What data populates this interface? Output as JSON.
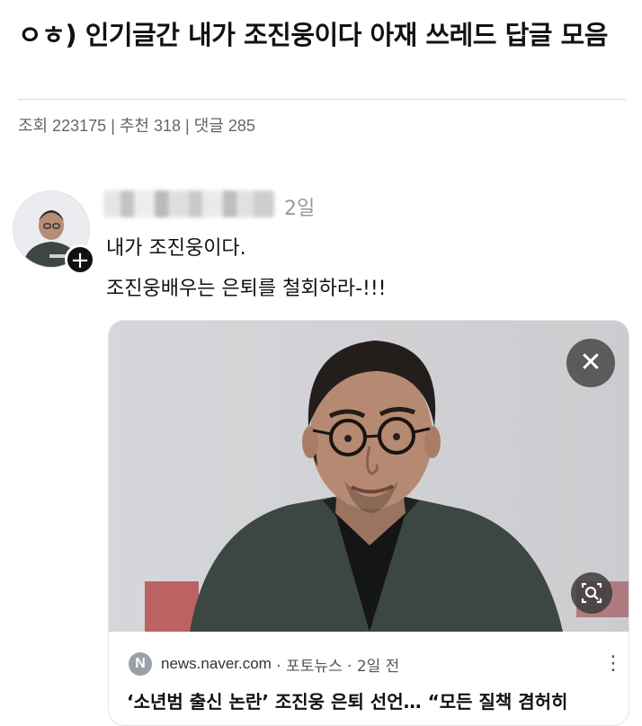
{
  "post": {
    "title": "ㅇㅎ) 인기글간 내가 조진웅이다 아재 쓰레드 답글 모음",
    "meta": {
      "views": "조회 223175",
      "sep1": " | ",
      "likes": "추천 318",
      "sep2": " | ",
      "comments": "댓글 285"
    }
  },
  "thread": {
    "time": "2일",
    "line1": "내가 조진웅이다.",
    "line2": "조진웅배우는 은퇴를 철회하라-!!!",
    "add_icon": "plus-icon"
  },
  "card": {
    "source_initial": "N",
    "source_site": "news.naver.com",
    "source_rest": " · 포토뉴스 · 2일 전",
    "headline": "‘소년범 출신 논란’ 조진웅 은퇴 선언… “모든 질책 겸허히",
    "close_icon": "close-icon",
    "lens_icon": "lens-search-icon",
    "more_icon": "more-vertical-icon"
  }
}
